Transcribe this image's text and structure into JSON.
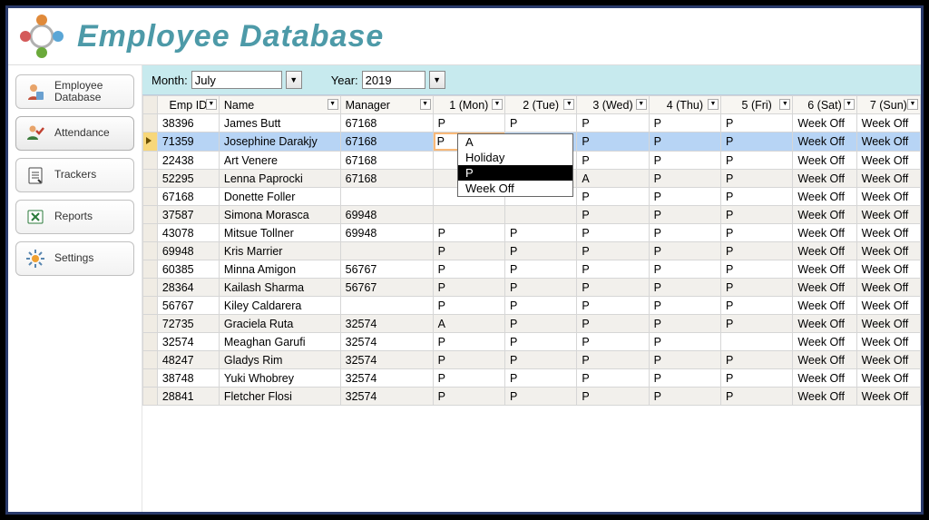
{
  "header": {
    "title": "Employee Database"
  },
  "sidebar": {
    "items": [
      {
        "label": "Employee\nDatabase"
      },
      {
        "label": "Attendance"
      },
      {
        "label": "Trackers"
      },
      {
        "label": "Reports"
      },
      {
        "label": "Settings"
      }
    ]
  },
  "filters": {
    "monthLabel": "Month:",
    "monthValue": "July",
    "yearLabel": "Year:",
    "yearValue": "2019"
  },
  "columns": [
    "Emp ID",
    "Name",
    "Manager",
    "1 (Mon)",
    "2 (Tue)",
    "3 (Wed)",
    "4 (Thu)",
    "5 (Fri)",
    "6 (Sat)",
    "7 (Sun)"
  ],
  "cellEditor": {
    "value": "P"
  },
  "dropdownOptions": [
    "A",
    "Holiday",
    "P",
    "Week Off"
  ],
  "dropdownSelected": "P",
  "rows": [
    {
      "id": "38396",
      "name": "James Butt",
      "mgr": "67168",
      "d": [
        "P",
        "P",
        "P",
        "P",
        "P",
        "Week Off",
        "Week Off"
      ]
    },
    {
      "id": "71359",
      "name": "Josephine Darakjy",
      "mgr": "67168",
      "d": [
        "P",
        "P",
        "P",
        "P",
        "P",
        "Week Off",
        "Week Off"
      ],
      "selected": true,
      "editing": 0
    },
    {
      "id": "22438",
      "name": "Art Venere",
      "mgr": "67168",
      "d": [
        "",
        "",
        "P",
        "P",
        "P",
        "Week Off",
        "Week Off"
      ]
    },
    {
      "id": "52295",
      "name": "Lenna Paprocki",
      "mgr": "67168",
      "d": [
        "",
        "",
        "A",
        "P",
        "P",
        "Week Off",
        "Week Off"
      ]
    },
    {
      "id": "67168",
      "name": "Donette Foller",
      "mgr": "",
      "d": [
        "",
        "",
        "P",
        "P",
        "P",
        "Week Off",
        "Week Off"
      ]
    },
    {
      "id": "37587",
      "name": "Simona Morasca",
      "mgr": "69948",
      "d": [
        "",
        "",
        "P",
        "P",
        "P",
        "Week Off",
        "Week Off"
      ]
    },
    {
      "id": "43078",
      "name": "Mitsue Tollner",
      "mgr": "69948",
      "d": [
        "P",
        "P",
        "P",
        "P",
        "P",
        "Week Off",
        "Week Off"
      ]
    },
    {
      "id": "69948",
      "name": "Kris Marrier",
      "mgr": "",
      "d": [
        "P",
        "P",
        "P",
        "P",
        "P",
        "Week Off",
        "Week Off"
      ]
    },
    {
      "id": "60385",
      "name": "Minna Amigon",
      "mgr": "56767",
      "d": [
        "P",
        "P",
        "P",
        "P",
        "P",
        "Week Off",
        "Week Off"
      ]
    },
    {
      "id": "28364",
      "name": "Kailash Sharma",
      "mgr": "56767",
      "d": [
        "P",
        "P",
        "P",
        "P",
        "P",
        "Week Off",
        "Week Off"
      ]
    },
    {
      "id": "56767",
      "name": "Kiley Caldarera",
      "mgr": "",
      "d": [
        "P",
        "P",
        "P",
        "P",
        "P",
        "Week Off",
        "Week Off"
      ]
    },
    {
      "id": "72735",
      "name": "Graciela Ruta",
      "mgr": "32574",
      "d": [
        "A",
        "P",
        "P",
        "P",
        "P",
        "Week Off",
        "Week Off"
      ]
    },
    {
      "id": "32574",
      "name": "Meaghan Garufi",
      "mgr": "32574",
      "d": [
        "P",
        "P",
        "P",
        "P",
        "",
        "Week Off",
        "Week Off"
      ]
    },
    {
      "id": "48247",
      "name": "Gladys Rim",
      "mgr": "32574",
      "d": [
        "P",
        "P",
        "P",
        "P",
        "P",
        "Week Off",
        "Week Off"
      ]
    },
    {
      "id": "38748",
      "name": "Yuki Whobrey",
      "mgr": "32574",
      "d": [
        "P",
        "P",
        "P",
        "P",
        "P",
        "Week Off",
        "Week Off"
      ]
    },
    {
      "id": "28841",
      "name": "Fletcher Flosi",
      "mgr": "32574",
      "d": [
        "P",
        "P",
        "P",
        "P",
        "P",
        "Week Off",
        "Week Off"
      ]
    }
  ]
}
